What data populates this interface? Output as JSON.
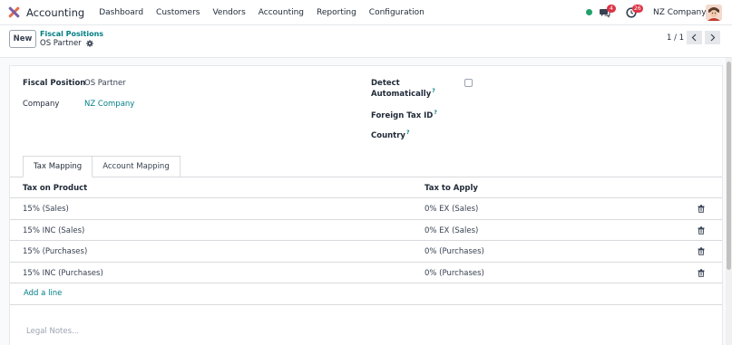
{
  "navbar": {
    "app_name": "Accounting",
    "menu": [
      "Dashboard",
      "Customers",
      "Vendors",
      "Accounting",
      "Reporting",
      "Configuration"
    ],
    "messages_count": "4",
    "activities_count": "26",
    "company": "NZ Company"
  },
  "control": {
    "new_label": "New",
    "breadcrumb_parent": "Fiscal Positions",
    "breadcrumb_current": "OS Partner",
    "pager": "1 / 1"
  },
  "form": {
    "fiscal_position_label": "Fiscal Position",
    "fiscal_position_value": "OS Partner",
    "company_label": "Company",
    "company_value": "NZ Company",
    "detect_label_1": "Detect",
    "detect_label_2": "Automatically",
    "foreign_tax_label": "Foreign Tax ID",
    "country_label": "Country",
    "help_mark": "?"
  },
  "tabs": [
    "Tax Mapping",
    "Account Mapping"
  ],
  "table": {
    "headers": [
      "Tax on Product",
      "Tax to Apply"
    ],
    "rows": [
      [
        "15% (Sales)",
        "0% EX (Sales)"
      ],
      [
        "15% INC (Sales)",
        "0% EX (Sales)"
      ],
      [
        "15% (Purchases)",
        "0% (Purchases)"
      ],
      [
        "15% INC (Purchases)",
        "0% (Purchases)"
      ]
    ],
    "add_line": "Add a line"
  },
  "notes_placeholder": "Legal Notes..."
}
